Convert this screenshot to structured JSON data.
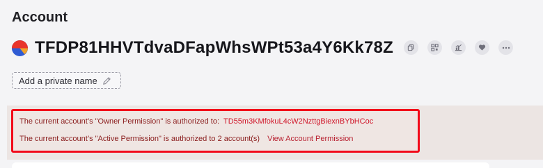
{
  "header": {
    "title": "Account"
  },
  "account": {
    "address": "TFDP81HHVTdvaDFapWhsWPt53a4Y6Kk78Z",
    "logo_icon": "tron-ball-icon",
    "actions": [
      {
        "name": "copy-icon"
      },
      {
        "name": "qr-code-icon"
      },
      {
        "name": "analytics-icon"
      },
      {
        "name": "heart-icon"
      },
      {
        "name": "more-icon"
      }
    ]
  },
  "private_name": {
    "label": "Add a private name",
    "icon": "pencil-icon"
  },
  "permissions": {
    "owner_text": "The current account’s \"Owner Permission\" is authorized to:",
    "owner_address": "TD55m3KMfokuL4cW2NzttgBiexnBYbHCoc",
    "active_text": "The current account’s \"Active Permission\" is authorized to 2 account(s)",
    "view_link": "View Account Permission"
  },
  "colors": {
    "accent_red": "#f20a1a",
    "link_red": "#d0162a",
    "notice_text": "#8a1c1c"
  }
}
